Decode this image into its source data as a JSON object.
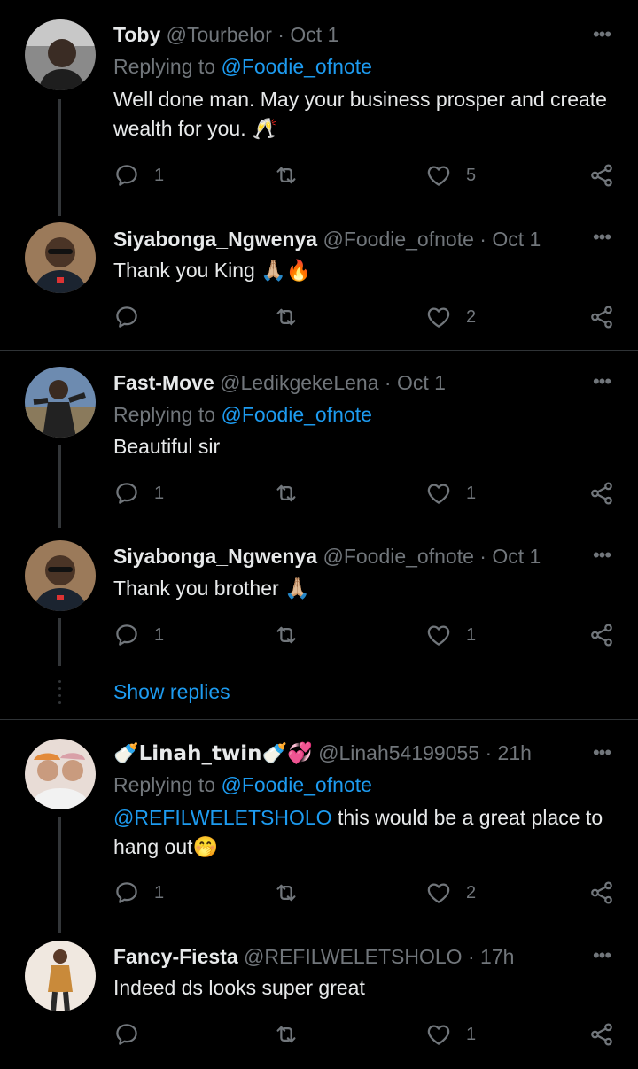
{
  "colors": {
    "background": "#000000",
    "accent": "#1d9bf0",
    "muted": "#71767b",
    "text": "#e7e9ea"
  },
  "replying_prefix": "Replying to",
  "tweets": [
    {
      "name": "Toby",
      "handle": "@Tourbelor",
      "sep": " · ",
      "time": "Oct 1",
      "replying_to": "@Foodie_ofnote",
      "text": "Well done man. May your business prosper and create wealth for you. 🥂",
      "replies": "1",
      "retweets": "",
      "likes": "5"
    },
    {
      "name": "Siyabonga_Ngwenya",
      "handle": "@Foodie_ofnote",
      "sep": " · ",
      "time": "Oct 1",
      "text": "Thank you King 🙏🏼🔥",
      "replies": "",
      "retweets": "",
      "likes": "2"
    },
    {
      "name": "Fast-Move",
      "handle": "@LedikgekeLena",
      "sep": " · ",
      "time": "Oct 1",
      "replying_to": "@Foodie_ofnote",
      "text": "Beautiful sir",
      "replies": "1",
      "retweets": "",
      "likes": "1"
    },
    {
      "name": "Siyabonga_Ngwenya",
      "handle": "@Foodie_ofnote",
      "sep": " · ",
      "time": "Oct 1",
      "text": "Thank you brother 🙏🏼",
      "replies": "1",
      "retweets": "",
      "likes": "1"
    },
    {
      "name": "🍼Linah_twin🍼💞",
      "handle": "@Linah54199055",
      "sep": " · ",
      "time": "21h",
      "replying_to": "@Foodie_ofnote",
      "text_mention": "@REFILWELETSHOLO",
      "text": " this would be a great place to hang out🤭",
      "replies": "1",
      "retweets": "",
      "likes": "2"
    },
    {
      "name": "Fancy-Fiesta",
      "handle": "@REFILWELETSHOLO",
      "sep": " · ",
      "time": "17h",
      "text": "Indeed ds looks super great",
      "replies": "",
      "retweets": "",
      "likes": "1"
    }
  ],
  "show_replies": "Show replies",
  "icons": {
    "reply": "reply-icon",
    "retweet": "retweet-icon",
    "like": "heart-icon",
    "share": "share-icon",
    "more": "more-icon"
  },
  "more_glyph": "•••"
}
